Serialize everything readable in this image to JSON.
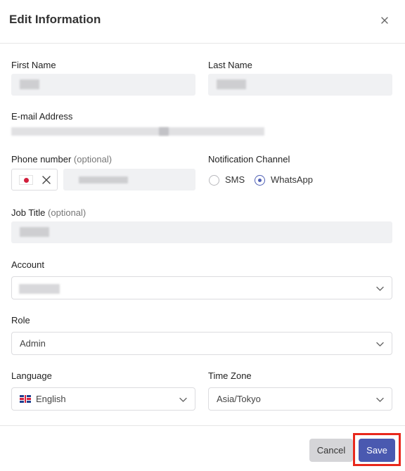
{
  "dialog": {
    "title": "Edit Information"
  },
  "form": {
    "first_name_label": "First Name",
    "last_name_label": "Last Name",
    "email_label": "E-mail Address",
    "phone_label": "Phone number",
    "phone_optional": "(optional)",
    "notification_label": "Notification Channel",
    "sms_label": "SMS",
    "whatsapp_label": "WhatsApp",
    "notification_selected": "WhatsApp",
    "job_title_label": "Job Title",
    "job_title_optional": "(optional)",
    "account_label": "Account",
    "role_label": "Role",
    "role_value": "Admin",
    "language_label": "Language",
    "language_value": "English",
    "timezone_label": "Time Zone",
    "timezone_value": "Asia/Tokyo"
  },
  "footer": {
    "cancel_label": "Cancel",
    "save_label": "Save"
  },
  "colors": {
    "accent": "#4a59b0",
    "highlight": "#e8281c"
  },
  "icons": [
    "close-icon",
    "japan-flag-icon",
    "clear-icon",
    "chevron-down-icon",
    "uk-flag-icon"
  ]
}
